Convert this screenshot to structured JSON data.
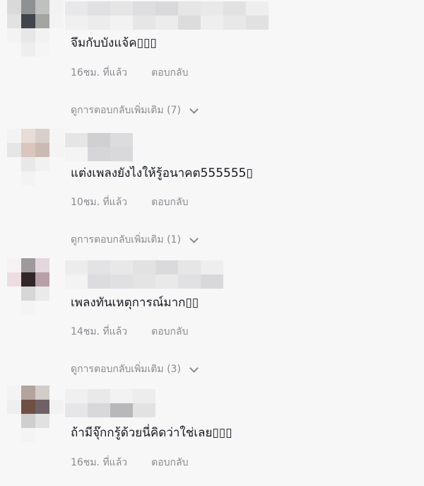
{
  "comments": [
    {
      "text": "จึมกับบังแจ้ค▯▯▯",
      "time": "16ชม. ที่แล้ว",
      "reply": "ตอบกลับ",
      "more": "ดูการตอบกลับเพิ่มเติม (7)"
    },
    {
      "text": "แต่งเพลงยังไงให้รู้อนาคต555555▯",
      "time": "10ชม. ที่แล้ว",
      "reply": "ตอบกลับ",
      "more": "ดูการตอบกลับเพิ่มเติม (1)"
    },
    {
      "text": "เพลงทันเหตุการณ์มาก▯▯",
      "time": "14ชม. ที่แล้ว",
      "reply": "ตอบกลับ",
      "more": "ดูการตอบกลับเพิ่มเติม (3)"
    },
    {
      "text": "ถ้ามีจุ๊กกรู้ด้วยนี่คิดว่าใช่เลย▯▯▯",
      "time": "16ชม. ที่แล้ว",
      "reply": "ตอบกลับ"
    }
  ],
  "colors": {
    "background": "#f7f7f7",
    "text": "#161823",
    "muted": "#8a8b91"
  },
  "icons": {
    "expand": "chevron-down-icon"
  }
}
